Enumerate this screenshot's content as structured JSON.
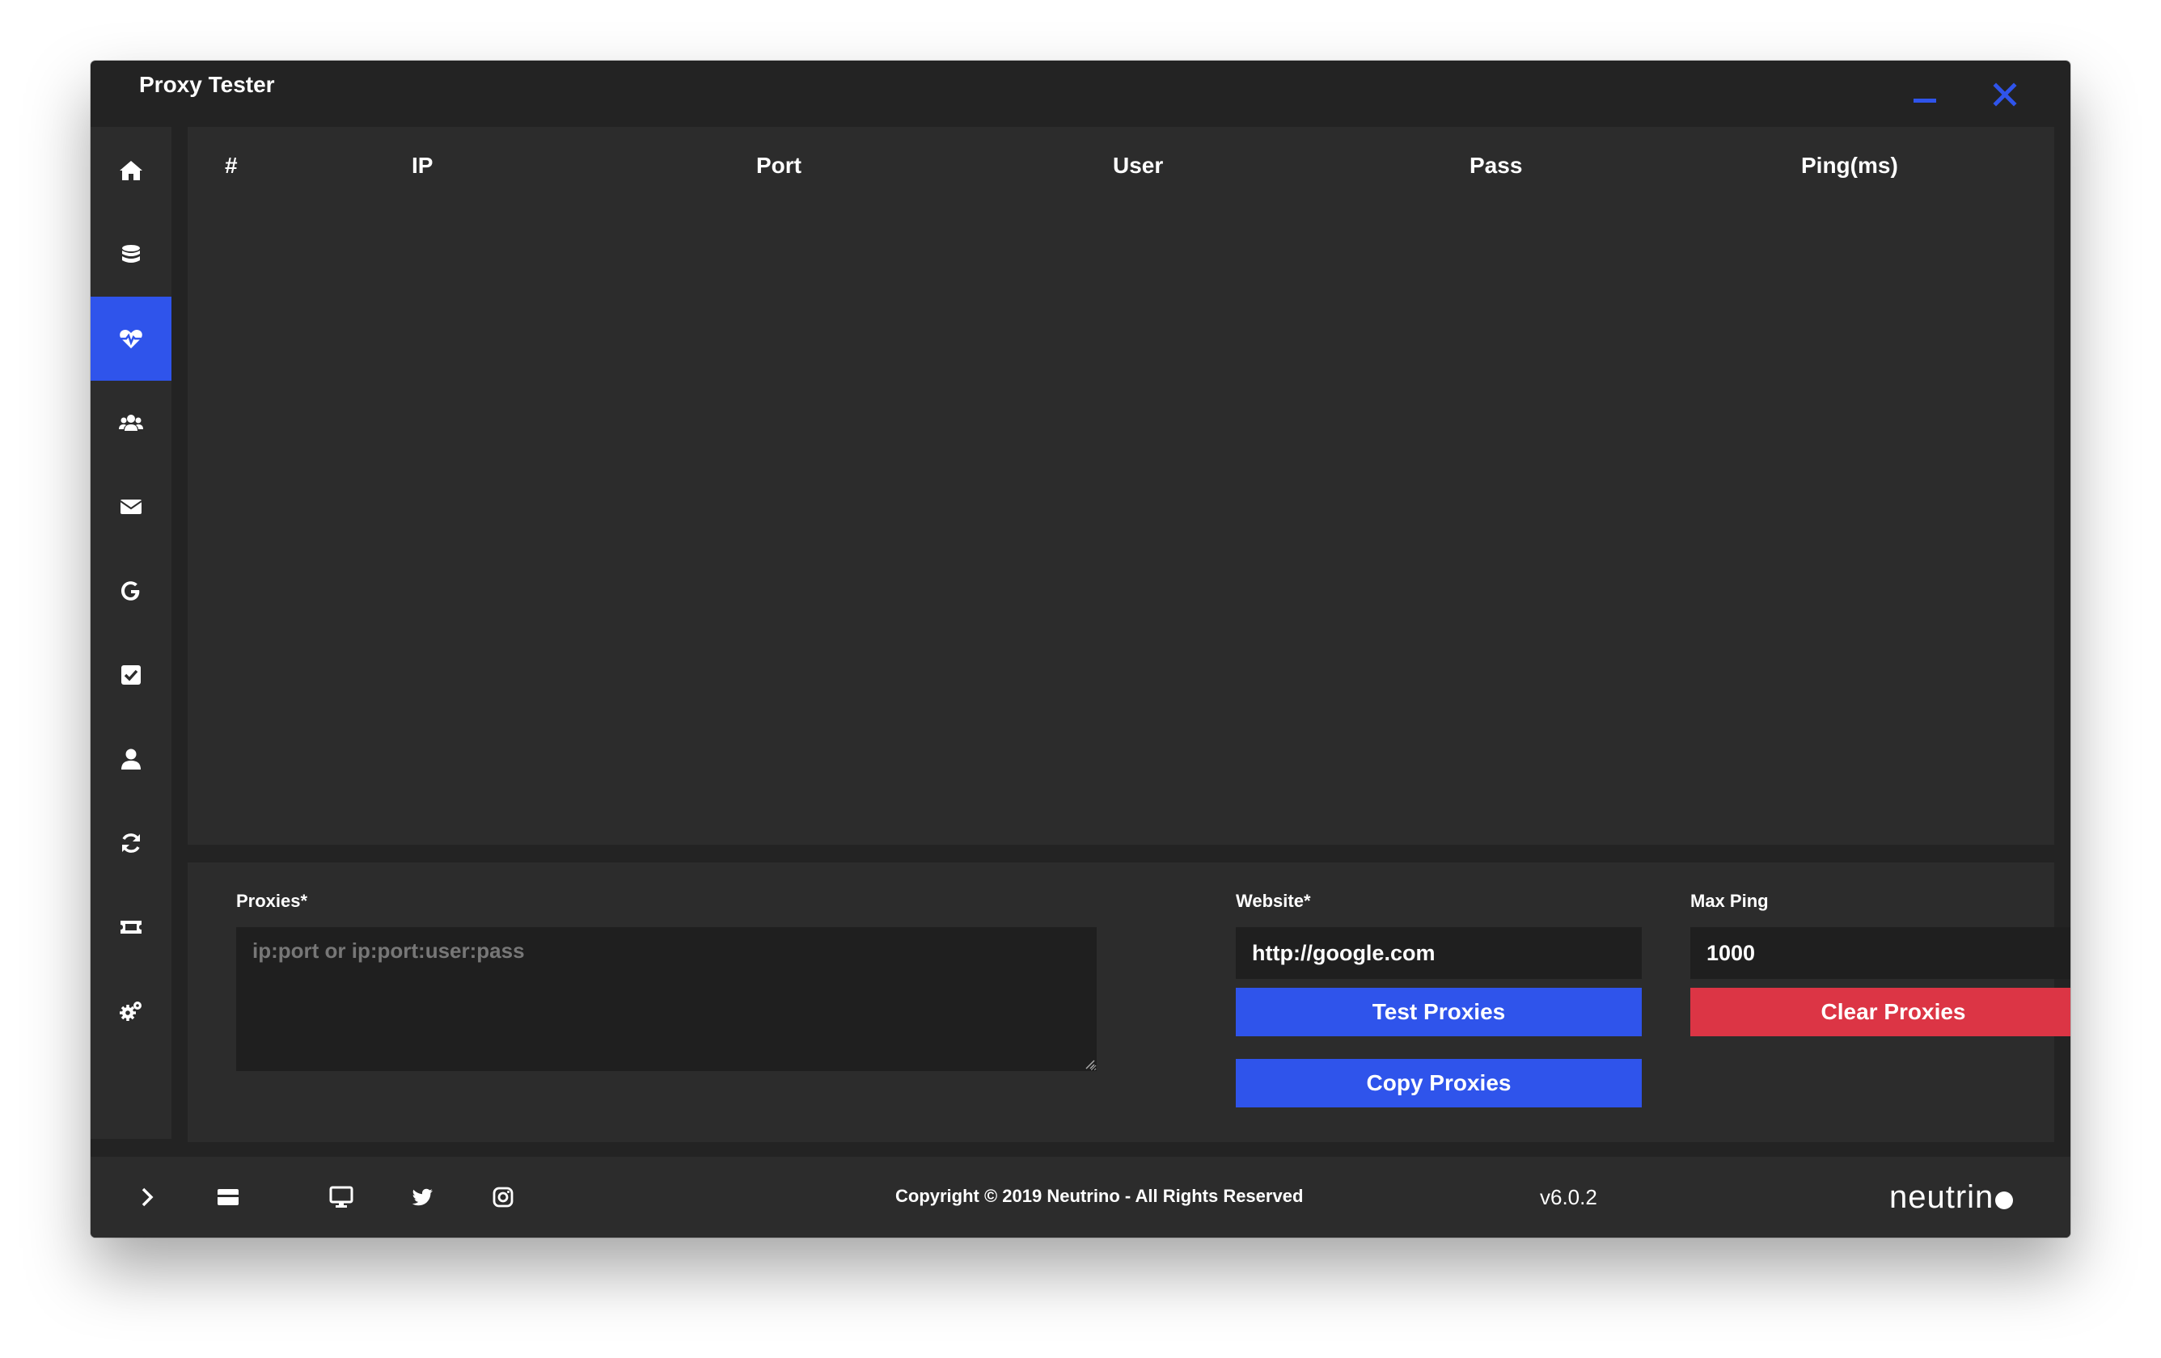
{
  "window": {
    "title": "Proxy Tester"
  },
  "sidebar": {
    "items": [
      {
        "icon": "home-icon",
        "name": "sidebar-item-home"
      },
      {
        "icon": "database-icon",
        "name": "sidebar-item-database"
      },
      {
        "icon": "heartbeat-icon",
        "name": "sidebar-item-proxy-tester",
        "active": true
      },
      {
        "icon": "users-icon",
        "name": "sidebar-item-users"
      },
      {
        "icon": "envelope-icon",
        "name": "sidebar-item-mail"
      },
      {
        "icon": "google-icon",
        "name": "sidebar-item-google"
      },
      {
        "icon": "checkbox-icon",
        "name": "sidebar-item-tasks"
      },
      {
        "icon": "user-icon",
        "name": "sidebar-item-profile"
      },
      {
        "icon": "sync-icon",
        "name": "sidebar-item-sync"
      },
      {
        "icon": "ticket-icon",
        "name": "sidebar-item-tickets"
      },
      {
        "icon": "cogs-icon",
        "name": "sidebar-item-settings"
      }
    ]
  },
  "table": {
    "columns": [
      "#",
      "IP",
      "Port",
      "User",
      "Pass",
      "Ping(ms)"
    ],
    "rows": []
  },
  "form": {
    "proxies_label": "Proxies*",
    "proxies_placeholder": "ip:port or ip:port:user:pass",
    "proxies_value": "",
    "website_label": "Website*",
    "website_value": "http://google.com",
    "max_ping_label": "Max Ping",
    "max_ping_value": "1000",
    "test_button": "Test Proxies",
    "clear_button": "Clear Proxies",
    "copy_button": "Copy Proxies"
  },
  "footer": {
    "icons": [
      "chevron-right-icon",
      "card-icon",
      "monitor-icon",
      "twitter-icon",
      "instagram-icon"
    ],
    "copyright": "Copyright © 2019 Neutrino - All Rights Reserved",
    "version": "v6.0.2",
    "brand": "neutrin"
  },
  "colors": {
    "accent": "#2f54eb",
    "danger": "#dc3545",
    "background": "#232323",
    "panel": "#2c2c2c",
    "input": "#1f1f1f"
  }
}
